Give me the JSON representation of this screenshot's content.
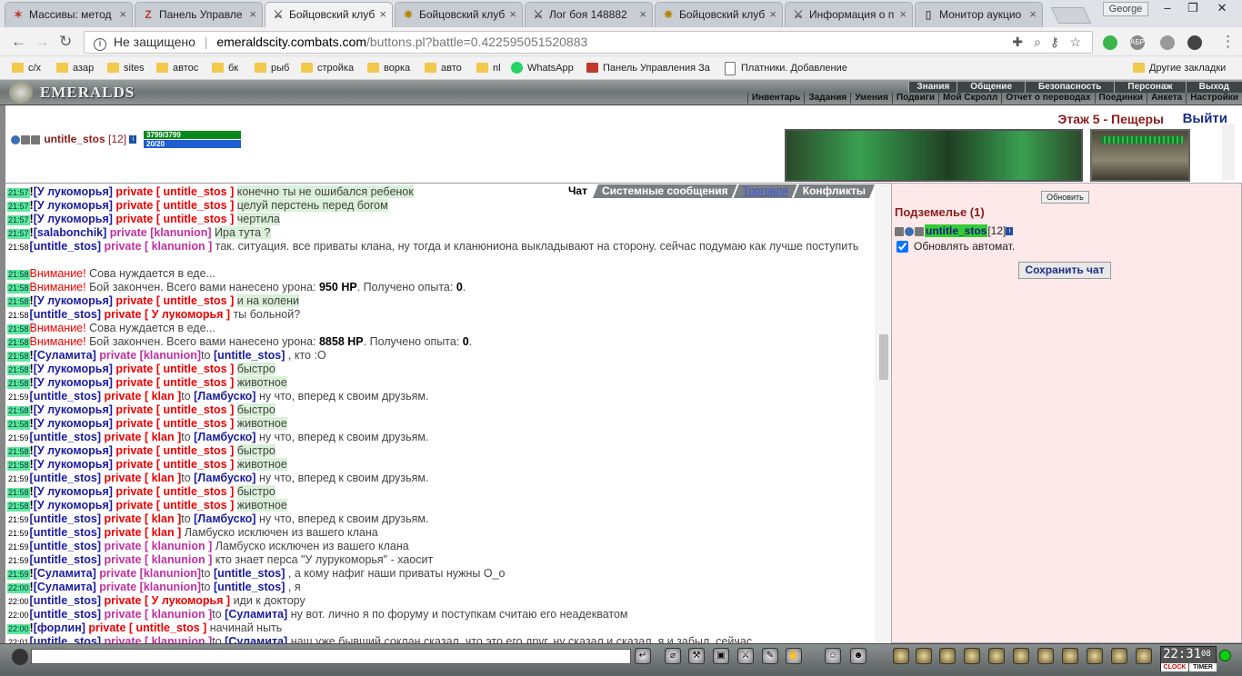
{
  "browser": {
    "tabs": [
      {
        "title": "Массивы: метод",
        "icon": "✶",
        "color": "#c0392b"
      },
      {
        "title": "Панель Управле",
        "icon": "Z",
        "color": "#c0392b"
      },
      {
        "title": "Бойцовский клуб",
        "icon": "⚔",
        "color": "#555"
      },
      {
        "title": "Бойцовский клуб",
        "icon": "✸",
        "color": "#b8860b"
      },
      {
        "title": "Лог боя 148882",
        "icon": "⚔",
        "color": "#555"
      },
      {
        "title": "Бойцовский клуб",
        "icon": "✸",
        "color": "#b8860b"
      },
      {
        "title": "Информация о п",
        "icon": "⚔",
        "color": "#555"
      },
      {
        "title": "Монитор аукцио",
        "icon": "▯",
        "color": "#555"
      }
    ],
    "active_tab": 2,
    "profile": "George",
    "window_buttons": [
      "–",
      "❐",
      "✕"
    ],
    "security": "Не защищено",
    "url_host": "emeraldscity.combats.com",
    "url_path": "/buttons.pl?battle=0.422595051520883",
    "extensions": [
      "green",
      "АБР",
      "gray",
      "dark"
    ],
    "bookmarks": [
      "с/х",
      "азар",
      "sites",
      "автос",
      "бк",
      "рыб",
      "стройка",
      "ворка",
      "авто",
      "nl",
      "WhatsApp",
      "Панель Управления За",
      "Платники. Добавление"
    ],
    "other_bookmarks": "Другие закладки"
  },
  "game": {
    "logo": "EMERALDS",
    "nav_top": [
      "Знания",
      "Общение",
      "Безопасность",
      "Персонаж",
      "Выход"
    ],
    "nav_bottom": [
      "Инвентарь",
      "Задания",
      "Умения",
      "Подвиги",
      "Мой Скролл",
      "Отчет о переводах",
      "Поединки",
      "Анкета",
      "Настройки"
    ],
    "character": {
      "nick": "untitle_stos",
      "level": "[12]",
      "hp": "3799/3799",
      "mana": "20/20"
    },
    "location": "Этаж 5 - Пещеры",
    "exit": "Выйти",
    "chat_tabs": [
      "Чат",
      "Системные сообщения",
      "Торговля",
      "Конфликты"
    ],
    "right": {
      "refresh": "Обновить",
      "room": "Подземелье (1)",
      "nick": "untitle_stos",
      "level": "[12]",
      "auto": "Обновлять автомат.",
      "save": "Сохранить чат"
    },
    "clock": {
      "time": "22:31",
      "sec": "08",
      "clock_label": "CLOCK",
      "timer_label": "TIMER"
    },
    "messages": [
      {
        "t": "21:57",
        "hl": true,
        "parts": [
          [
            "!",
            "bk"
          ],
          [
            "[У лукоморья]",
            "p"
          ],
          [
            " private [ untitle_stos ] ",
            "pr"
          ],
          [
            "конечно ты не ошибался ребенок",
            "gr"
          ]
        ]
      },
      {
        "t": "21:57",
        "hl": true,
        "parts": [
          [
            "!",
            "bk"
          ],
          [
            "[У лукоморья]",
            "p"
          ],
          [
            " private [ untitle_stos ] ",
            "pr"
          ],
          [
            "целуй перстень перед богом",
            "gr"
          ]
        ]
      },
      {
        "t": "21:57",
        "hl": true,
        "parts": [
          [
            "!",
            "bk"
          ],
          [
            "[У лукоморья]",
            "p"
          ],
          [
            " private [ untitle_stos ] ",
            "pr"
          ],
          [
            "чертила",
            "gr"
          ]
        ]
      },
      {
        "t": "21:57",
        "hl": true,
        "parts": [
          [
            "!",
            "bk"
          ],
          [
            "[salabonchik]",
            "p"
          ],
          [
            " private [klanunion] ",
            "pc"
          ],
          [
            "Ира тута ?",
            "gr"
          ]
        ]
      },
      {
        "t": "21:58",
        "hl": false,
        "wrap": true,
        "parts": [
          [
            "[untitle_stos]",
            "p"
          ],
          [
            " private [ klanunion ] ",
            "pc"
          ],
          [
            "так. ситуация. все приваты клана, ну тогда и кланюниона выкладывают на сторону. сейчас подумаю как лучше поступить",
            "tx"
          ]
        ]
      },
      {
        "t": "21:58",
        "hl": true,
        "parts": [
          [
            "Внимание!",
            "sm"
          ],
          [
            " Сова нуждается в еде...",
            "tx"
          ]
        ]
      },
      {
        "t": "21:58",
        "hl": true,
        "parts": [
          [
            "Внимание!",
            "sm"
          ],
          [
            " Бой закончен. Всего вами нанесено урона: ",
            "tx"
          ],
          [
            "950 HP",
            "bk"
          ],
          [
            ". Получено опыта: ",
            "tx"
          ],
          [
            "0",
            "bk"
          ],
          [
            ".",
            "tx"
          ]
        ]
      },
      {
        "t": "21:58",
        "hl": true,
        "parts": [
          [
            "!",
            "bk"
          ],
          [
            "[У лукоморья]",
            "p"
          ],
          [
            " private [ untitle_stos ] ",
            "pr"
          ],
          [
            "и на колени",
            "gr"
          ]
        ]
      },
      {
        "t": "21:58",
        "hl": false,
        "parts": [
          [
            "[untitle_stos]",
            "p"
          ],
          [
            " private [ У лукоморья ] ",
            "pr"
          ],
          [
            "ты больной?",
            "tx"
          ]
        ]
      },
      {
        "t": "21:58",
        "hl": true,
        "parts": [
          [
            "Внимание!",
            "sm"
          ],
          [
            " Сова нуждается в еде...",
            "tx"
          ]
        ]
      },
      {
        "t": "21:58",
        "hl": true,
        "parts": [
          [
            "Внимание!",
            "sm"
          ],
          [
            " Бой закончен. Всего вами нанесено урона: ",
            "tx"
          ],
          [
            "8858 HP",
            "bk"
          ],
          [
            ". Получено опыта: ",
            "tx"
          ],
          [
            "0",
            "bk"
          ],
          [
            ".",
            "tx"
          ]
        ]
      },
      {
        "t": "21:58",
        "hl": true,
        "parts": [
          [
            "!",
            "bk"
          ],
          [
            "[Суламита]",
            "p"
          ],
          [
            " private [klanunion]",
            "pc"
          ],
          [
            "to ",
            "tx"
          ],
          [
            "[untitle_stos]",
            "p"
          ],
          [
            " , кто :О",
            "tx"
          ]
        ]
      },
      {
        "t": "21:58",
        "hl": true,
        "parts": [
          [
            "!",
            "bk"
          ],
          [
            "[У лукоморья]",
            "p"
          ],
          [
            " private [ untitle_stos ] ",
            "pr"
          ],
          [
            "быстро",
            "gr"
          ]
        ]
      },
      {
        "t": "21:58",
        "hl": true,
        "parts": [
          [
            "!",
            "bk"
          ],
          [
            "[У лукоморья]",
            "p"
          ],
          [
            " private [ untitle_stos ] ",
            "pr"
          ],
          [
            "животное",
            "gr"
          ]
        ]
      },
      {
        "t": "21:59",
        "hl": false,
        "parts": [
          [
            "[untitle_stos]",
            "p"
          ],
          [
            " private [ klan ]",
            "pr"
          ],
          [
            "to ",
            "tx"
          ],
          [
            "[Ламбуско]",
            "p"
          ],
          [
            " ну что, вперед к своим друзьям.",
            "tx"
          ]
        ]
      },
      {
        "t": "21:58",
        "hl": true,
        "parts": [
          [
            "!",
            "bk"
          ],
          [
            "[У лукоморья]",
            "p"
          ],
          [
            " private [ untitle_stos ] ",
            "pr"
          ],
          [
            "быстро",
            "gr"
          ]
        ]
      },
      {
        "t": "21:58",
        "hl": true,
        "parts": [
          [
            "!",
            "bk"
          ],
          [
            "[У лукоморья]",
            "p"
          ],
          [
            " private [ untitle_stos ] ",
            "pr"
          ],
          [
            "животное",
            "gr"
          ]
        ]
      },
      {
        "t": "21:59",
        "hl": false,
        "parts": [
          [
            "[untitle_stos]",
            "p"
          ],
          [
            " private [ klan ]",
            "pr"
          ],
          [
            "to ",
            "tx"
          ],
          [
            "[Ламбуско]",
            "p"
          ],
          [
            " ну что, вперед к своим друзьям.",
            "tx"
          ]
        ]
      },
      {
        "t": "21:58",
        "hl": true,
        "parts": [
          [
            "!",
            "bk"
          ],
          [
            "[У лукоморья]",
            "p"
          ],
          [
            " private [ untitle_stos ] ",
            "pr"
          ],
          [
            "быстро",
            "gr"
          ]
        ]
      },
      {
        "t": "21:58",
        "hl": true,
        "parts": [
          [
            "!",
            "bk"
          ],
          [
            "[У лукоморья]",
            "p"
          ],
          [
            " private [ untitle_stos ] ",
            "pr"
          ],
          [
            "животное",
            "gr"
          ]
        ]
      },
      {
        "t": "21:59",
        "hl": false,
        "parts": [
          [
            "[untitle_stos]",
            "p"
          ],
          [
            " private [ klan ]",
            "pr"
          ],
          [
            "to ",
            "tx"
          ],
          [
            "[Ламбуско]",
            "p"
          ],
          [
            " ну что, вперед к своим друзьям.",
            "tx"
          ]
        ]
      },
      {
        "t": "21:58",
        "hl": true,
        "parts": [
          [
            "!",
            "bk"
          ],
          [
            "[У лукоморья]",
            "p"
          ],
          [
            " private [ untitle_stos ] ",
            "pr"
          ],
          [
            "быстро",
            "gr"
          ]
        ]
      },
      {
        "t": "21:58",
        "hl": true,
        "parts": [
          [
            "!",
            "bk"
          ],
          [
            "[У лукоморья]",
            "p"
          ],
          [
            " private [ untitle_stos ] ",
            "pr"
          ],
          [
            "животное",
            "gr"
          ]
        ]
      },
      {
        "t": "21:59",
        "hl": false,
        "parts": [
          [
            "[untitle_stos]",
            "p"
          ],
          [
            " private [ klan ]",
            "pr"
          ],
          [
            "to ",
            "tx"
          ],
          [
            "[Ламбуско]",
            "p"
          ],
          [
            " ну что, вперед к своим друзьям.",
            "tx"
          ]
        ]
      },
      {
        "t": "21:59",
        "hl": false,
        "parts": [
          [
            "[untitle_stos]",
            "p"
          ],
          [
            " private [ klan ] ",
            "pr"
          ],
          [
            "Ламбуско исключен из вашего клана",
            "tx"
          ]
        ]
      },
      {
        "t": "21:59",
        "hl": false,
        "parts": [
          [
            "[untitle_stos]",
            "p"
          ],
          [
            " private [ klanunion ] ",
            "pc"
          ],
          [
            "Ламбуско исключен из вашего клана",
            "tx"
          ]
        ]
      },
      {
        "t": "21:59",
        "hl": false,
        "parts": [
          [
            "[untitle_stos]",
            "p"
          ],
          [
            " private [ klanunion ] ",
            "pc"
          ],
          [
            "кто знает перса \"У лурукоморья\" - хаосит",
            "tx"
          ]
        ]
      },
      {
        "t": "21:59",
        "hl": true,
        "parts": [
          [
            "!",
            "bk"
          ],
          [
            "[Суламита]",
            "p"
          ],
          [
            " private [klanunion]",
            "pc"
          ],
          [
            "to ",
            "tx"
          ],
          [
            "[untitle_stos]",
            "p"
          ],
          [
            " , а кому нафиг наши приваты нужны О_о",
            "tx"
          ]
        ]
      },
      {
        "t": "22:00",
        "hl": true,
        "parts": [
          [
            "!",
            "bk"
          ],
          [
            "[Суламита]",
            "p"
          ],
          [
            " private [klanunion]",
            "pc"
          ],
          [
            "to ",
            "tx"
          ],
          [
            "[untitle_stos]",
            "p"
          ],
          [
            " , я",
            "tx"
          ]
        ]
      },
      {
        "t": "22:00",
        "hl": false,
        "parts": [
          [
            "[untitle_stos]",
            "p"
          ],
          [
            " private [ У лукоморья ] ",
            "pr"
          ],
          [
            "иди к доктору",
            "tx"
          ]
        ]
      },
      {
        "t": "22:00",
        "hl": false,
        "parts": [
          [
            "[untitle_stos]",
            "p"
          ],
          [
            " private [ klanunion ]",
            "pc"
          ],
          [
            "to ",
            "tx"
          ],
          [
            "[Суламита]",
            "p"
          ],
          [
            " ну вот. лично я по форуму и поступкам считаю его неадекватом",
            "tx"
          ]
        ]
      },
      {
        "t": "22:00",
        "hl": true,
        "parts": [
          [
            "!",
            "bk"
          ],
          [
            "[форлин]",
            "p"
          ],
          [
            " private [ untitle_stos ] ",
            "pr"
          ],
          [
            "начинай ныть",
            "tx"
          ]
        ]
      },
      {
        "t": "22:01",
        "hl": false,
        "parts": [
          [
            "[untitle_stos]",
            "p"
          ],
          [
            " private [ klanunion ]",
            "pc"
          ],
          [
            "to ",
            "tx"
          ],
          [
            "[Суламита]",
            "p"
          ],
          [
            " наш уже бывший соклан сказал, что это его друг. ну сказал и сказал, я и забыл. сейчас",
            "tx"
          ]
        ]
      }
    ]
  }
}
